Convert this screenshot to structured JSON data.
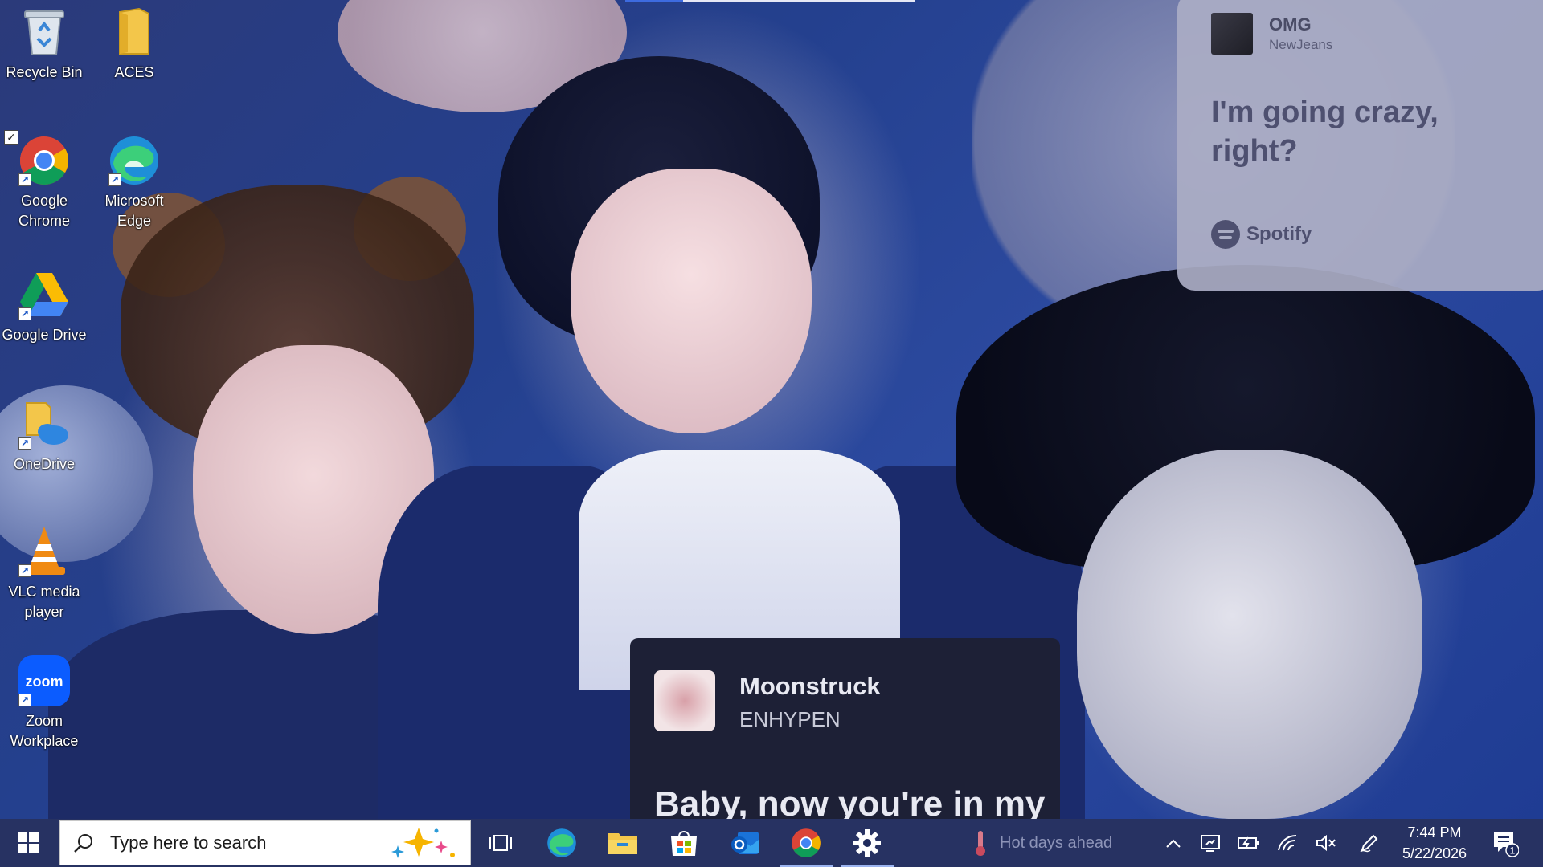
{
  "desktop": {
    "icons": [
      {
        "label": "Recycle Bin"
      },
      {
        "label": "ACES"
      },
      {
        "label": "Google Chrome"
      },
      {
        "label": "Microsoft Edge"
      },
      {
        "label": "Google Drive"
      },
      {
        "label": "OneDrive"
      },
      {
        "label": "VLC media player"
      },
      {
        "label": "Zoom Workplace"
      }
    ]
  },
  "wallpaper": {
    "spotify_card": {
      "song": "OMG",
      "artist": "NewJeans",
      "lyric": "I'm going crazy, right?",
      "brand": "Spotify"
    },
    "music_card": {
      "song": "Moonstruck",
      "artist": "ENHYPEN",
      "lyric": "Baby, now you're in my"
    }
  },
  "taskbar": {
    "search_placeholder": "Type here to search",
    "apps": [
      {
        "name": "Task View",
        "icon": "task-view-icon",
        "active": false
      },
      {
        "name": "Microsoft Edge",
        "icon": "edge-icon",
        "active": false
      },
      {
        "name": "File Explorer",
        "icon": "folder-icon",
        "active": false
      },
      {
        "name": "Microsoft Store",
        "icon": "store-icon",
        "active": false
      },
      {
        "name": "Outlook",
        "icon": "outlook-icon",
        "active": false
      },
      {
        "name": "Google Chrome",
        "icon": "chrome-icon",
        "active": true
      },
      {
        "name": "Settings",
        "icon": "gear-icon",
        "active": true
      }
    ],
    "weather_text": "Hot days ahead",
    "clock_time": "7:44 PM",
    "clock_date": "5/22/2026",
    "notification_count": "1"
  },
  "colors": {
    "taskbar_bg": "#1e2a5c",
    "accent": "#3d6be0"
  }
}
